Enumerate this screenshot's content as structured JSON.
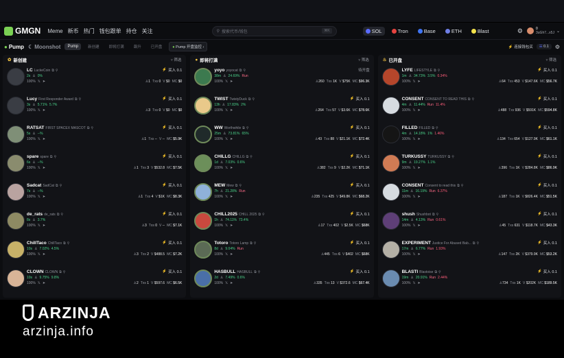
{
  "app": {
    "logo": "GMGN",
    "nav": [
      "Meme",
      "新币",
      "热门",
      "钱包跟单",
      "持仓",
      "关注"
    ],
    "search_placeholder": "搜索代币/钱包",
    "search_shortcut": "⌘K",
    "chains": [
      "SOL",
      "Tron",
      "Base",
      "ETH",
      "Blast"
    ],
    "account_balance": "0",
    "account_addr": "3uGh7...x5J"
  },
  "subbar": {
    "tab_pump": "Pump",
    "tab_moonshot": "Moonshot",
    "segments": [
      "Pump",
      "新创建",
      "即将打满",
      "飙升",
      "已开盘"
    ],
    "monitor": "Pump 开盘监控",
    "connect": "连接钱包买",
    "amount": "0.1"
  },
  "colors": {
    "green": "#4bd38b",
    "red": "#ff5d7a",
    "bg": "#0c0d10"
  },
  "columns": [
    {
      "title": "新创建",
      "filter": "筛选",
      "rows": [
        {
          "symbol": "LC",
          "name": "LuckeCoin",
          "age": "2s",
          "pct1": "0%",
          "pct2": "",
          "pct3": "",
          "holders": "1",
          "tx": "0",
          "vol": "$0",
          "mc": "$0",
          "buy": "买入 0.1",
          "avatar": "#3a3d44"
        },
        {
          "symbol": "Lucy",
          "name": "First Responder Award",
          "age": "3s",
          "pct1": "5.71%",
          "pct2": "5.7%",
          "pct3": "",
          "holders": "3",
          "tx": "0",
          "vol": "$0",
          "mc": "$0",
          "buy": "买入 0.1",
          "avatar": "#3a3d44"
        },
        {
          "symbol": "RATSAT",
          "name": "FIRST SPACEX MASCOT",
          "age": "5s",
          "pct1": "--%",
          "pct2": "",
          "pct3": "",
          "holders": "1",
          "tx": "--",
          "vol": "--",
          "mc": "$5.9K",
          "buy": "买入 0.1",
          "avatar": "#7f8f77"
        },
        {
          "symbol": "spare",
          "name": "spare",
          "age": "6s",
          "pct1": "--%",
          "pct2": "",
          "pct3": "",
          "holders": "1",
          "tx": "3",
          "vol": "$532.8",
          "mc": "$7.5K",
          "buy": "买入 0.1",
          "avatar": "#8a8c6e"
        },
        {
          "symbol": "Sadcat",
          "name": "SadCat",
          "age": "7s",
          "pct1": "--%",
          "pct2": "",
          "pct3": "",
          "holders": "1",
          "tx": "4",
          "vol": "$1K",
          "mc": "$8.3K",
          "buy": "买入 0.1",
          "avatar": "#b9a3a0"
        },
        {
          "symbol": "de_rats",
          "name": "de_rats",
          "age": "8s",
          "pct1": "3.7%",
          "pct2": "",
          "pct3": "",
          "holders": "3",
          "tx": "0",
          "vol": "--",
          "mc": "$7.1K",
          "buy": "买入 0.1",
          "avatar": "#8e8a63"
        },
        {
          "symbol": "ChillTaco",
          "name": "ChillTaco",
          "age": "10s",
          "pct1": "7.02%",
          "pct2": "4.5%",
          "pct3": "",
          "holders": "3",
          "tx": "2",
          "vol": "$488.5",
          "mc": "$7.2K",
          "buy": "买入 0.1",
          "avatar": "#c7b168"
        },
        {
          "symbol": "CLOWN",
          "name": "CLOWN",
          "age": "10s",
          "pct1": "9.75%",
          "pct2": "9.8%",
          "pct3": "",
          "holders": "2",
          "tx": "1",
          "vol": "$597.6",
          "mc": "$6.5K",
          "buy": "买入 0.1",
          "avatar": "#d8b497"
        }
      ]
    },
    {
      "title": "即将打满",
      "filter": "筛选",
      "rows": [
        {
          "symbol": "yoyo",
          "name": "yoyocat",
          "age": "38m",
          "pct1": "24.69%",
          "pct2": "Run",
          "pct3": "",
          "holders": "260",
          "tx": "1K",
          "vol": "$75K",
          "mc": "$96.3K",
          "buy": "待开盘",
          "avatar": "#3c7a4f"
        },
        {
          "symbol": "TWIST",
          "name": "TwistyDuck",
          "age": "13h",
          "pct1": "17.83%",
          "pct2": "2%",
          "pct3": "",
          "holders": "264",
          "tx": "57",
          "vol": "$3.6K",
          "mc": "$78.6K",
          "buy": "买入 0.1",
          "avatar": "#e9c98a"
        },
        {
          "symbol": "WW",
          "name": "Worthwhile",
          "age": "25m",
          "pct1": "73.81%",
          "pct2": "65%",
          "pct3": "",
          "holders": "43",
          "tx": "88",
          "vol": "$21.1K",
          "mc": "$72.4K",
          "buy": "买入 0.1",
          "avatar": "#202a2a"
        },
        {
          "symbol": "CHILLG",
          "name": "CHILLG",
          "age": "1d",
          "pct1": "7.03%",
          "pct2": "0.6%",
          "pct3": "",
          "holders": "382",
          "tx": "9",
          "vol": "$2.2K",
          "mc": "$71.1K",
          "buy": "买入 0.1",
          "avatar": "#6c8f5a"
        },
        {
          "symbol": "MEW",
          "name": "Mew",
          "age": "7h",
          "pct1": "21.28%",
          "pct2": "Run",
          "pct3": "",
          "holders": "235",
          "tx": "425",
          "vol": "$49.8K",
          "mc": "$68.2K",
          "buy": "买入 0.1",
          "avatar": "#8fb1d9"
        },
        {
          "symbol": "CHILL2025",
          "name": "CHILL 2025",
          "age": "1h",
          "pct1": "74.11%",
          "pct2": "73.4%",
          "pct3": "",
          "holders": "17",
          "tx": "402",
          "vol": "$2.5K",
          "mc": "$68K",
          "buy": "买入 0.1",
          "avatar": "#c9493e"
        },
        {
          "symbol": "Totoro",
          "name": "Totoro Lamp",
          "age": "8d",
          "pct1": "9.04%",
          "pct2": "Run",
          "pct3": "",
          "holders": "445",
          "tx": "6",
          "vol": "$402",
          "mc": "$68K",
          "buy": "买入 0.1",
          "avatar": "#5b6a55"
        },
        {
          "symbol": "HASBULL",
          "name": "HASBULL",
          "age": "2d",
          "pct1": "7.49%",
          "pct2": "0.6%",
          "pct3": "",
          "holders": "335",
          "tx": "13",
          "vol": "$372.6",
          "mc": "$67.4K",
          "buy": "买入 0.1",
          "avatar": "#4a6fa8"
        }
      ]
    },
    {
      "title": "已开盘",
      "filter": "筛选",
      "rows": [
        {
          "symbol": "LYFE",
          "name": "LIFESTYLE",
          "age": "1m",
          "pct1": "34.73%",
          "pct2": "3.5%",
          "pct3": "0.34%",
          "holders": "64",
          "tx": "453",
          "vol": "$147.6K",
          "mc": "$56.7K",
          "buy": "买入 0.1",
          "avatar": "#b5462b"
        },
        {
          "symbol": "CONSENT",
          "name": "CONSENT TO READ THIS",
          "age": "4m",
          "pct1": "11.44%",
          "pct2": "Run",
          "pct3": "11.4%",
          "holders": "488",
          "tx": "936",
          "vol": "$591K",
          "mc": "$594.8K",
          "buy": "买入 0.1",
          "avatar": "#d6dbe0"
        },
        {
          "symbol": "FILLED",
          "name": "FILLED",
          "age": "4m",
          "pct1": "14.18%",
          "pct2": "1%",
          "pct3": "1.46%",
          "holders": "134",
          "tx": "654",
          "vol": "$127.9K",
          "mc": "$61.1K",
          "buy": "买入 0.1",
          "avatar": "#151515"
        },
        {
          "symbol": "TURKUSSY",
          "name": "TURKUSSY",
          "age": "9m",
          "pct1": "19.27%",
          "pct2": "1.1%",
          "pct3": "",
          "holders": "396",
          "tx": "1K",
          "vol": "$284.8K",
          "mc": "$86.9K",
          "buy": "买入 0.1",
          "avatar": "#d07b54"
        },
        {
          "symbol": "CONSENT",
          "name": "Consent to read this",
          "age": "11m",
          "pct1": "16.19%",
          "pct2": "Run",
          "pct3": "6.37%",
          "holders": "187",
          "tx": "1K",
          "vol": "$826.4K",
          "mc": "$51.5K",
          "buy": "买入 0.1",
          "avatar": "#d6dbe0"
        },
        {
          "symbol": "shush",
          "name": "Shushbot",
          "age": "14m",
          "pct1": "4.13%",
          "pct2": "Run",
          "pct3": "0.61%",
          "holders": "45",
          "tx": "631",
          "vol": "$118.7K",
          "mc": "$43.3K",
          "buy": "买入 0.1",
          "avatar": "#5e3f77"
        },
        {
          "symbol": "EXPERIMENT",
          "name": "Justice For Abused Bab...",
          "age": "17m",
          "pct1": "6.77%",
          "pct2": "Run",
          "pct3": "1.93%",
          "holders": "147",
          "tx": "2K",
          "vol": "$379.9K",
          "mc": "$53.2K",
          "buy": "买入 0.1",
          "avatar": "#b4b0a6"
        },
        {
          "symbol": "BLASTI",
          "name": "Blastoise",
          "age": "19m",
          "pct1": "20.91%",
          "pct2": "Run",
          "pct3": "2.44%",
          "holders": "734",
          "tx": "1K",
          "vol": "$202K",
          "mc": "$189.5K",
          "buy": "买入 0.1",
          "avatar": "#6a8bb0"
        }
      ]
    }
  ],
  "watermark": {
    "brand": "ARZINJA",
    "site": "arzinja.info"
  }
}
